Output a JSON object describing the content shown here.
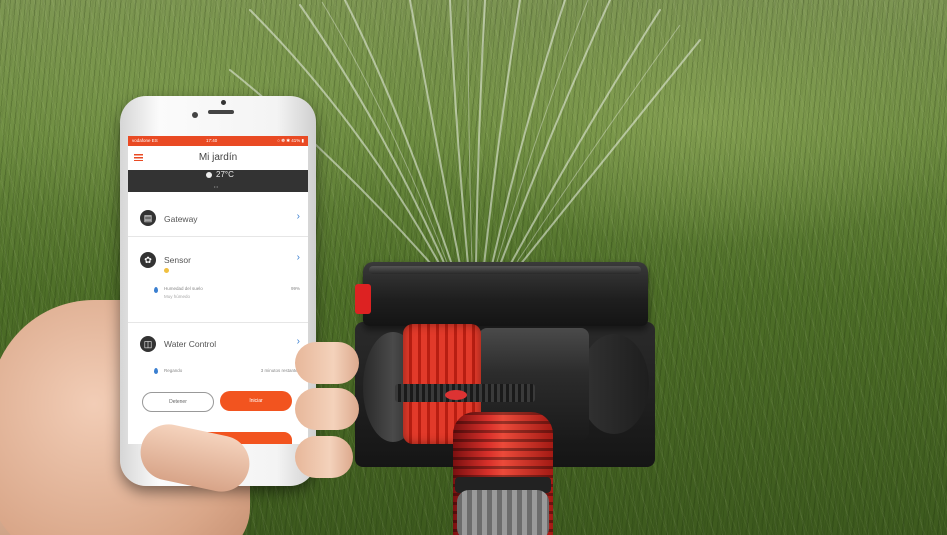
{
  "app": {
    "status_carrier": "vodafone ES",
    "status_time": "17:40",
    "status_right": "○ ❁ ✱ 41% ▮",
    "nav_title": "Mi jardín",
    "weather_temp": "27°C",
    "weather_pager": "• •"
  },
  "sections": [
    {
      "label": "Gateway",
      "chevron": "›",
      "icon": "gateway-icon"
    },
    {
      "label": "Sensor",
      "chevron": "›",
      "icon": "sensor-icon"
    },
    {
      "label": "Water Control",
      "chevron": "›",
      "icon": "water-control-icon"
    }
  ],
  "sensor_detail": {
    "label": "Humedad del suelo",
    "sublabel": "Muy húmedo",
    "value": "99%"
  },
  "water_detail": {
    "label": "Regando",
    "value": "3 minutos restantes"
  },
  "buttons": {
    "stop": "Detener",
    "start": "Iniciar"
  },
  "colors": {
    "accent": "#f2541f",
    "status_bar": "#e94a23",
    "link_blue": "#3a7fd0"
  }
}
